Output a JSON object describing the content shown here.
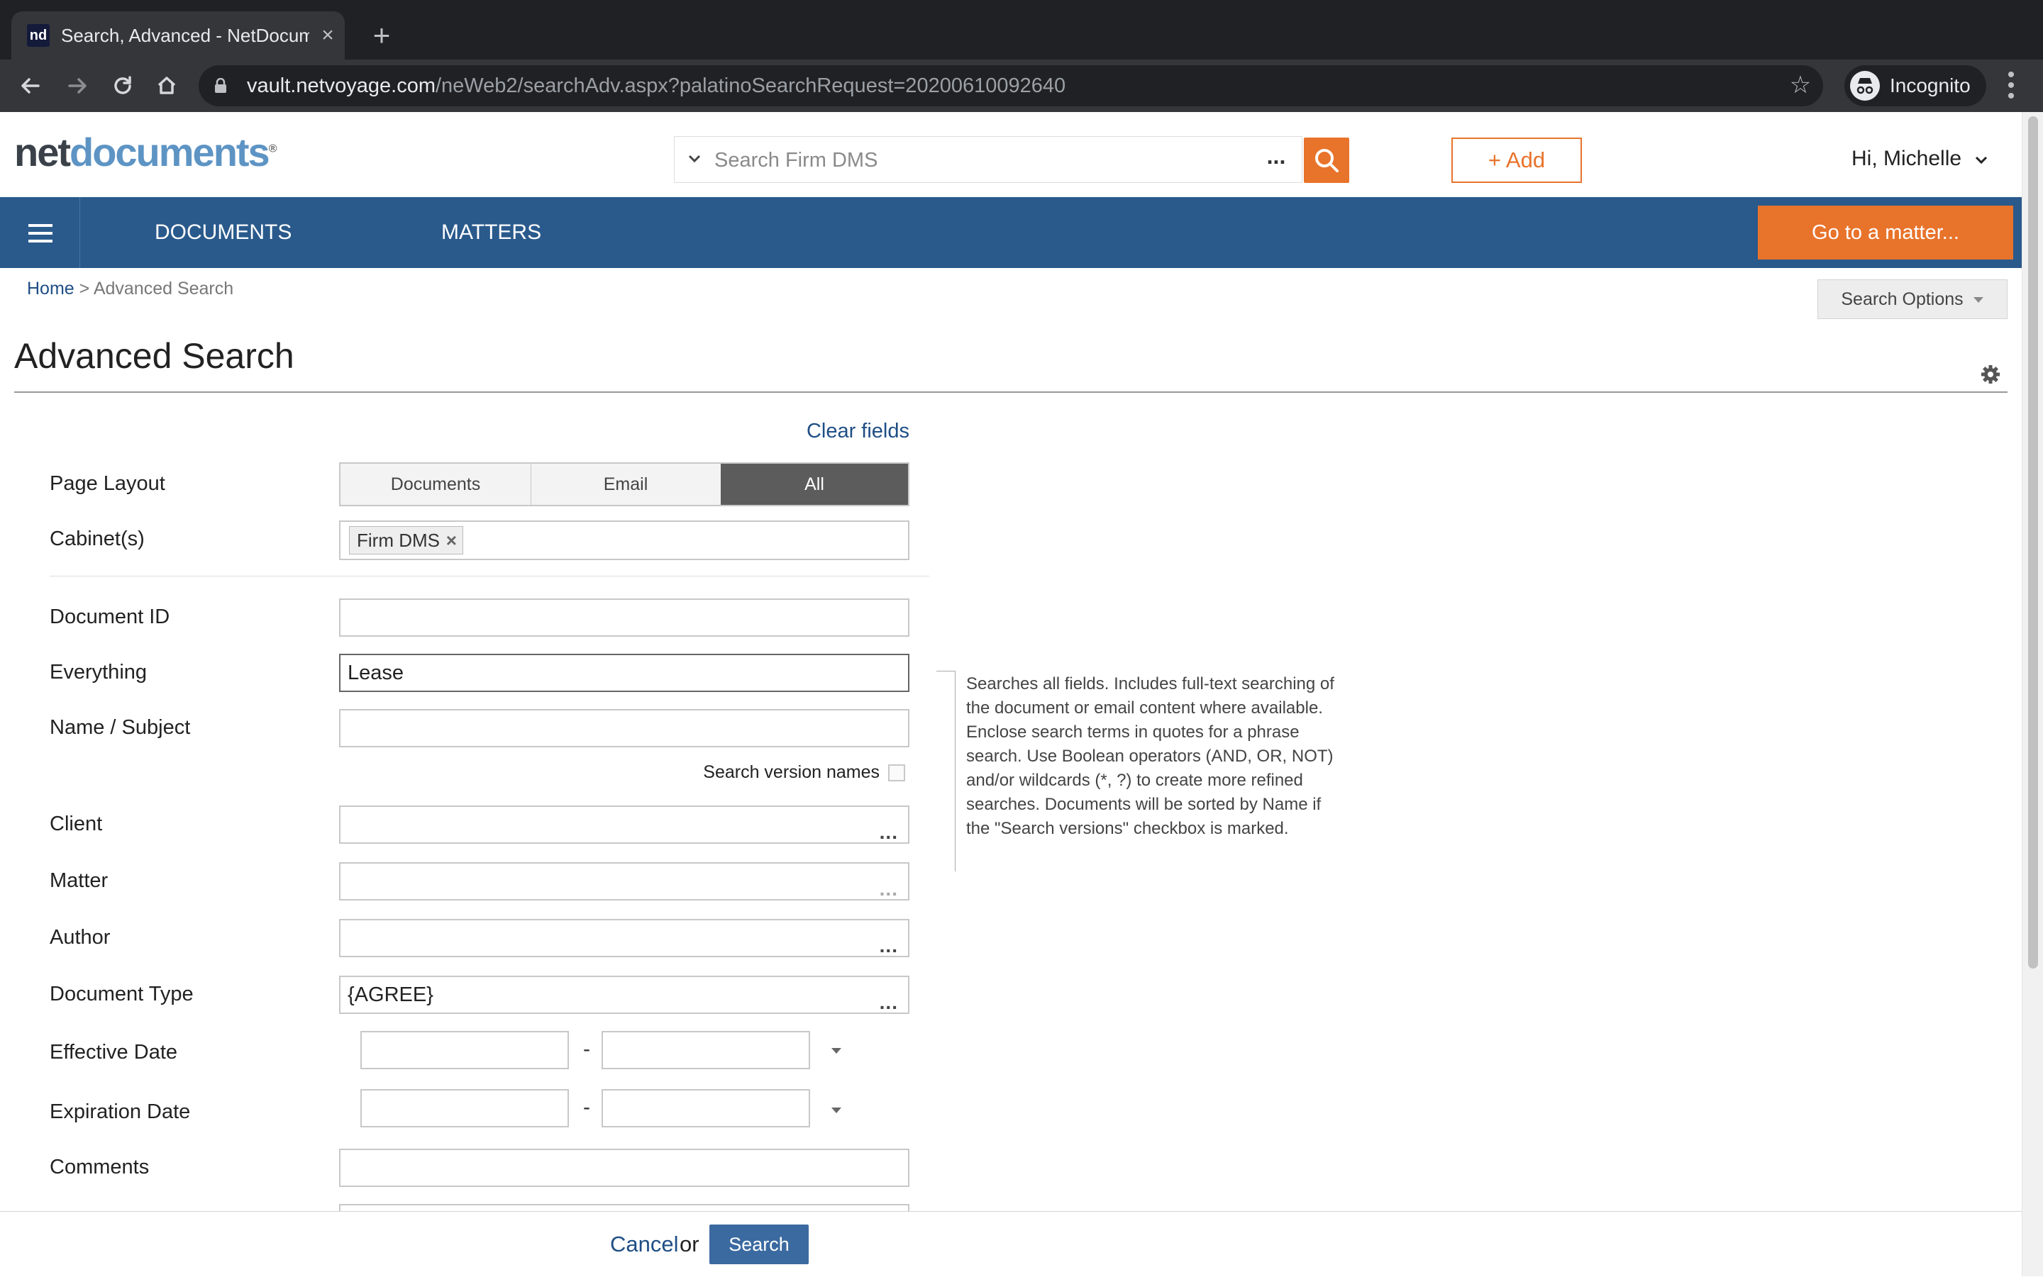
{
  "browser": {
    "tab_title": "Search, Advanced - NetDocuments",
    "favicon_text": "nd",
    "url_host": "vault.netvoyage.com",
    "url_path": "/neWeb2/searchAdv.aspx?palatinoSearchRequest=20200610092640",
    "profile_label": "Incognito"
  },
  "app": {
    "logo_part1": "net",
    "logo_part2": "documents",
    "logo_mark": "®",
    "search_placeholder": "Search Firm DMS",
    "search_more": "...",
    "add_label": "+ Add",
    "greeting": "Hi,  Michelle",
    "accent_color": "#e8732b",
    "nav_color": "#2a5a8c"
  },
  "nav": {
    "documents": "DOCUMENTS",
    "matters": "MATTERS",
    "goto_matter": "Go to a matter..."
  },
  "breadcrumb": {
    "home": "Home",
    "separator": " > ",
    "current": "Advanced Search"
  },
  "search_options_label": "Search Options",
  "page_title": "Advanced Search",
  "form": {
    "clear_fields": "Clear fields",
    "page_layout": {
      "label": "Page Layout",
      "options": [
        "Documents",
        "Email",
        "All"
      ],
      "selected": "All"
    },
    "cabinets": {
      "label": "Cabinet(s)",
      "chip": "Firm DMS"
    },
    "document_id": {
      "label": "Document ID",
      "value": ""
    },
    "everything": {
      "label": "Everything",
      "value": "Lease"
    },
    "name_subject": {
      "label": "Name / Subject",
      "value": ""
    },
    "search_version_names": "Search version names",
    "client": {
      "label": "Client",
      "value": ""
    },
    "matter": {
      "label": "Matter",
      "value": ""
    },
    "author": {
      "label": "Author",
      "value": ""
    },
    "document_type": {
      "label": "Document Type",
      "value": "{AGREE}"
    },
    "effective_date": {
      "label": "Effective Date",
      "dash": "-"
    },
    "expiration_date": {
      "label": "Expiration Date",
      "dash": "-"
    },
    "comments": {
      "label": "Comments",
      "value": ""
    },
    "lookup_dots": "...",
    "help_text": "Searches all fields. Includes full-text searching of the document or email content where available. Enclose search terms in quotes for a phrase search. Use Boolean operators (AND, OR, NOT) and/or wildcards (*, ?) to create more refined searches. Documents will be sorted by Name if the \"Search versions\" checkbox is marked."
  },
  "footer": {
    "cancel": "Cancel",
    "or": "or",
    "search": "Search"
  }
}
